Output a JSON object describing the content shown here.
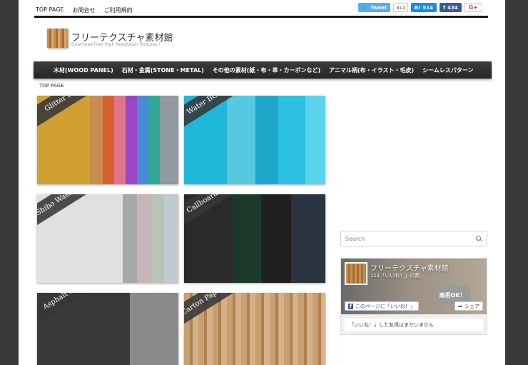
{
  "topnav": {
    "items": [
      "TOP PAGE",
      "お問合せ",
      "ご利用規約"
    ]
  },
  "social": {
    "tweet": "Tweet",
    "tweet_count": "814",
    "hatena": "B!",
    "hatena_count": "514",
    "facebook": "f",
    "facebook_count": "434",
    "gplus": "G+"
  },
  "logo": {
    "title": "フリーテクスチャ素材館",
    "subtitle": "Download Free High Resolution Textures !"
  },
  "mainnav": {
    "items": [
      "木材(WOOD PANEL)",
      "石材・金属(STONE・METAL)",
      "その他の素材(紙・布・革・カーボンなど)",
      "アニマル柄(布・イラスト・毛皮)",
      "シームレスパターン"
    ]
  },
  "breadcrumb": "TOP PAGE",
  "thumbs": [
    {
      "label": "Glitter Pattern set"
    },
    {
      "label": "Water BG Pattern set"
    },
    {
      "label": "Shibo Washi Pattern set"
    },
    {
      "label": "Callboard Pattern set"
    },
    {
      "label": "Asphalt Pattern set"
    },
    {
      "label": "Carton Paper Pattern set"
    }
  ],
  "search": {
    "placeholder": "Search"
  },
  "fb": {
    "title": "フリーテクスチャ素材館",
    "likes": "111「いいね！」の数",
    "badge": "商用OK！",
    "like_btn": "このページに「いいね！」",
    "share_btn": "シェア",
    "footer": "「いいね！」した友達はまだいません"
  },
  "colors": {
    "nav_bg": "#2e2e2e",
    "twitter": "#55acee",
    "hatena": "#1b8dd6",
    "facebook": "#3b5998"
  }
}
